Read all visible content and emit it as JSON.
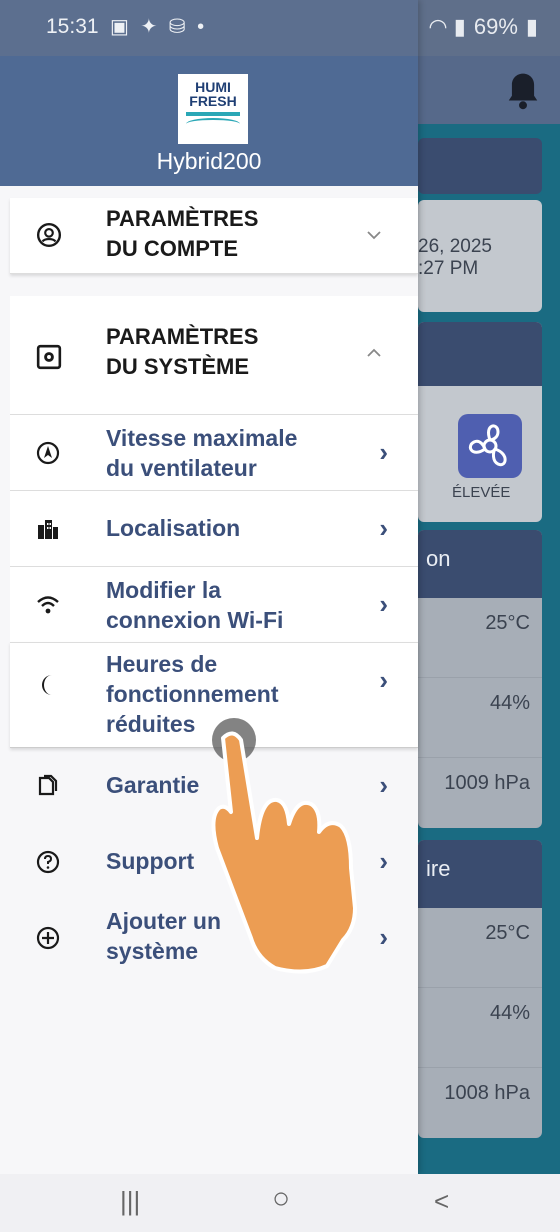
{
  "status_bar": {
    "time": "15:31",
    "icons": "▣ ✦ ⛁ •",
    "battery": "69%"
  },
  "background": {
    "date_line1": "26, 2025",
    "date_line2": ":27 PM",
    "fan_label": "ÉLEVÉE",
    "card1_header": "on",
    "card1_rows": [
      "25°C",
      "44%",
      "1009 hPa"
    ],
    "card2_header": "ire",
    "card2_rows": [
      "25°C",
      "44%",
      "1008 hPa"
    ]
  },
  "drawer": {
    "brand_name": "Hybrid200",
    "logo_line1": "HUMI",
    "logo_line2": "FRESH",
    "account_section": {
      "title": "PARAMÈTRES DU COMPTE",
      "line1": "PARAMÈTRES",
      "line2": "DU COMPTE"
    },
    "system_section": {
      "title": "PARAMÈTRES DU SYSTÈME",
      "line1": "PARAMÈTRES",
      "line2": "DU SYSTÈME"
    },
    "system_items": [
      {
        "line1": "Vitesse maximale",
        "line2": "du ventilateur",
        "icon": "compass-icon"
      },
      {
        "line1": "Localisation",
        "line2": "",
        "icon": "building-icon"
      },
      {
        "line1": "Modifier la",
        "line2": "connexion Wi-Fi",
        "icon": "wifi-icon"
      },
      {
        "line1": "Heures de",
        "line2": "fonctionnement",
        "line3": "réduites",
        "icon": "moon-icon"
      }
    ],
    "other_items": [
      {
        "label": "Garantie",
        "icon": "copy-icon"
      },
      {
        "label": "Support",
        "icon": "help-icon"
      },
      {
        "line1": "Ajouter un",
        "line2": "système",
        "icon": "plus-circle-icon"
      }
    ]
  },
  "nav_bar": {
    "recent": "|||",
    "home": "○",
    "back": "<"
  }
}
